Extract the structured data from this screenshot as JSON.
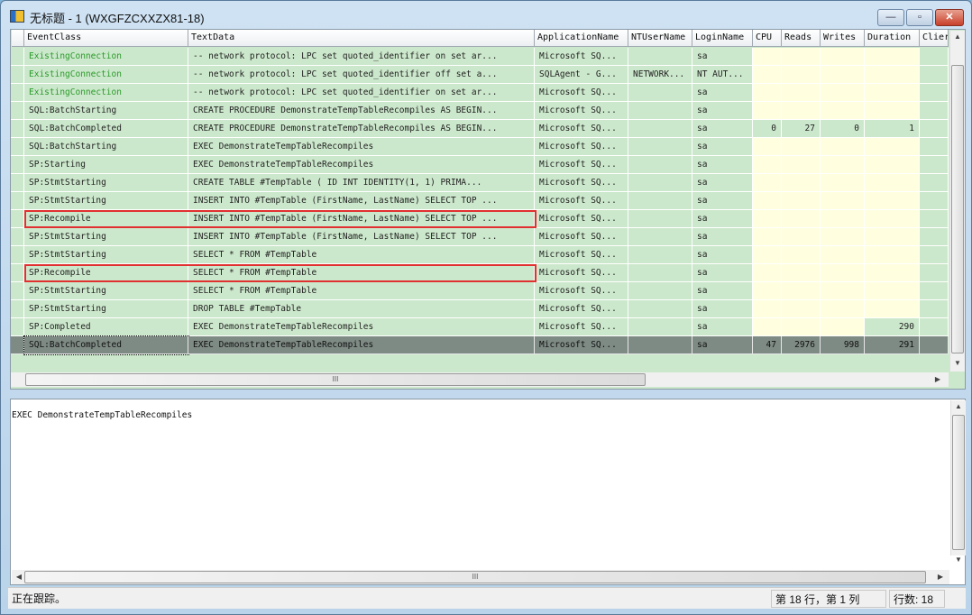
{
  "window": {
    "title": "无标题 - 1 (WXGFZCXXZX81-18)",
    "minimize": "—",
    "maximize": "▫",
    "close": "✕"
  },
  "trace": {
    "columns": [
      "EventClass",
      "TextData",
      "ApplicationName",
      "NTUserName",
      "LoginName",
      "CPU",
      "Reads",
      "Writes",
      "Duration",
      "Clier"
    ],
    "rows": [
      {
        "cells": [
          "ExistingConnection",
          "-- network protocol: LPC  set quoted_identifier on  set ar...",
          "Microsoft SQ...",
          "",
          "sa",
          "",
          "",
          "",
          ""
        ],
        "green": true
      },
      {
        "cells": [
          "ExistingConnection",
          "-- network protocol: LPC  set quoted_identifier off  set a...",
          "SQLAgent - G...",
          "NETWORK...",
          "NT AUT...",
          "",
          "",
          "",
          ""
        ],
        "green": true
      },
      {
        "cells": [
          "ExistingConnection",
          "-- network protocol: LPC  set quoted_identifier on  set ar...",
          "Microsoft SQ...",
          "",
          "sa",
          "",
          "",
          "",
          ""
        ],
        "green": true
      },
      {
        "cells": [
          "SQL:BatchStarting",
          "CREATE PROCEDURE DemonstrateTempTableRecompiles  AS  BEGIN...",
          "Microsoft SQ...",
          "",
          "sa",
          "",
          "",
          "",
          ""
        ]
      },
      {
        "cells": [
          "SQL:BatchCompleted",
          "CREATE PROCEDURE DemonstrateTempTableRecompiles  AS  BEGIN...",
          "Microsoft SQ...",
          "",
          "sa",
          "0",
          "27",
          "0",
          "1"
        ]
      },
      {
        "cells": [
          "SQL:BatchStarting",
          "  EXEC DemonstrateTempTableRecompiles",
          "Microsoft SQ...",
          "",
          "sa",
          "",
          "",
          "",
          ""
        ]
      },
      {
        "cells": [
          "SP:Starting",
          "EXEC DemonstrateTempTableRecompiles",
          "Microsoft SQ...",
          "",
          "sa",
          "",
          "",
          "",
          ""
        ]
      },
      {
        "cells": [
          "SP:StmtStarting",
          "CREATE TABLE #TempTable   (    ID INT IDENTITY(1, 1) PRIMA...",
          "Microsoft SQ...",
          "",
          "sa",
          "",
          "",
          "",
          ""
        ]
      },
      {
        "cells": [
          "SP:StmtStarting",
          "INSERT INTO #TempTable (FirstName, LastName)   SELECT TOP ...",
          "Microsoft SQ...",
          "",
          "sa",
          "",
          "",
          "",
          ""
        ]
      },
      {
        "cells": [
          "SP:Recompile",
          "INSERT INTO #TempTable (FirstName, LastName)   SELECT TOP ...",
          "Microsoft SQ...",
          "",
          "sa",
          "",
          "",
          "",
          ""
        ],
        "highlight": true
      },
      {
        "cells": [
          "SP:StmtStarting",
          "INSERT INTO #TempTable (FirstName, LastName)   SELECT TOP ...",
          "Microsoft SQ...",
          "",
          "sa",
          "",
          "",
          "",
          ""
        ]
      },
      {
        "cells": [
          "SP:StmtStarting",
          "SELECT * FROM #TempTable",
          "Microsoft SQ...",
          "",
          "sa",
          "",
          "",
          "",
          ""
        ]
      },
      {
        "cells": [
          "SP:Recompile",
          "SELECT * FROM #TempTable",
          "Microsoft SQ...",
          "",
          "sa",
          "",
          "",
          "",
          ""
        ],
        "highlight": true
      },
      {
        "cells": [
          "SP:StmtStarting",
          "SELECT * FROM #TempTable",
          "Microsoft SQ...",
          "",
          "sa",
          "",
          "",
          "",
          ""
        ]
      },
      {
        "cells": [
          "SP:StmtStarting",
          "DROP TABLE #TempTable",
          "Microsoft SQ...",
          "",
          "sa",
          "",
          "",
          "",
          ""
        ]
      },
      {
        "cells": [
          "SP:Completed",
          "EXEC DemonstrateTempTableRecompiles",
          "Microsoft SQ...",
          "",
          "sa",
          "",
          "",
          "",
          "290"
        ]
      },
      {
        "cells": [
          "SQL:BatchCompleted",
          "  EXEC DemonstrateTempTableRecompiles",
          "Microsoft SQ...",
          "",
          "sa",
          "47",
          "2976",
          "998",
          "291"
        ],
        "selected": true
      }
    ]
  },
  "detail": {
    "text": "EXEC DemonstrateTempTableRecompiles"
  },
  "scroll": {
    "grip": "III"
  },
  "status": {
    "message": "正在跟踪。",
    "position": "第 18 行，第 1 列",
    "rowcount": "行数: 18"
  },
  "colors": {
    "row": "#cce8cc",
    "empty_numeric": "#ffffe0",
    "selected": "#7e8a84",
    "highlight": "#e03030",
    "existing_connection": "#2a9a2a"
  }
}
